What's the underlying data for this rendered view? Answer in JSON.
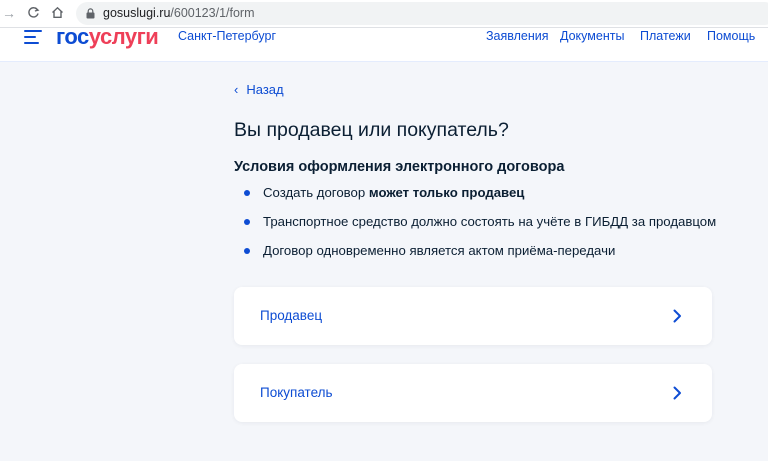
{
  "browser": {
    "nav_back": "→",
    "url_host": "gosuslugi.ru",
    "url_path": "/600123/1/form"
  },
  "header": {
    "logo_part1": "гос",
    "logo_part2": "услуги",
    "region": "Санкт-Петербург",
    "nav": [
      "Заявления",
      "Документы",
      "Платежи",
      "Помощь"
    ]
  },
  "content": {
    "back_label": "Назад",
    "title": "Вы продавец или покупатель?",
    "conditions_title": "Условия оформления электронного договора",
    "conditions": [
      {
        "text": "Создать договор ",
        "bold": "может только продавец"
      },
      {
        "text": "Транспортное средство должно состоять на учёте в ГИБДД за продавцом",
        "bold": ""
      },
      {
        "text": "Договор одновременно является актом приёма-передачи",
        "bold": ""
      }
    ],
    "options": [
      "Продавец",
      "Покупатель"
    ]
  },
  "colors": {
    "brand_blue": "#0d4cd3",
    "brand_red": "#ee3f58",
    "page_bg": "#f4f6fa",
    "text": "#0b1f33"
  }
}
